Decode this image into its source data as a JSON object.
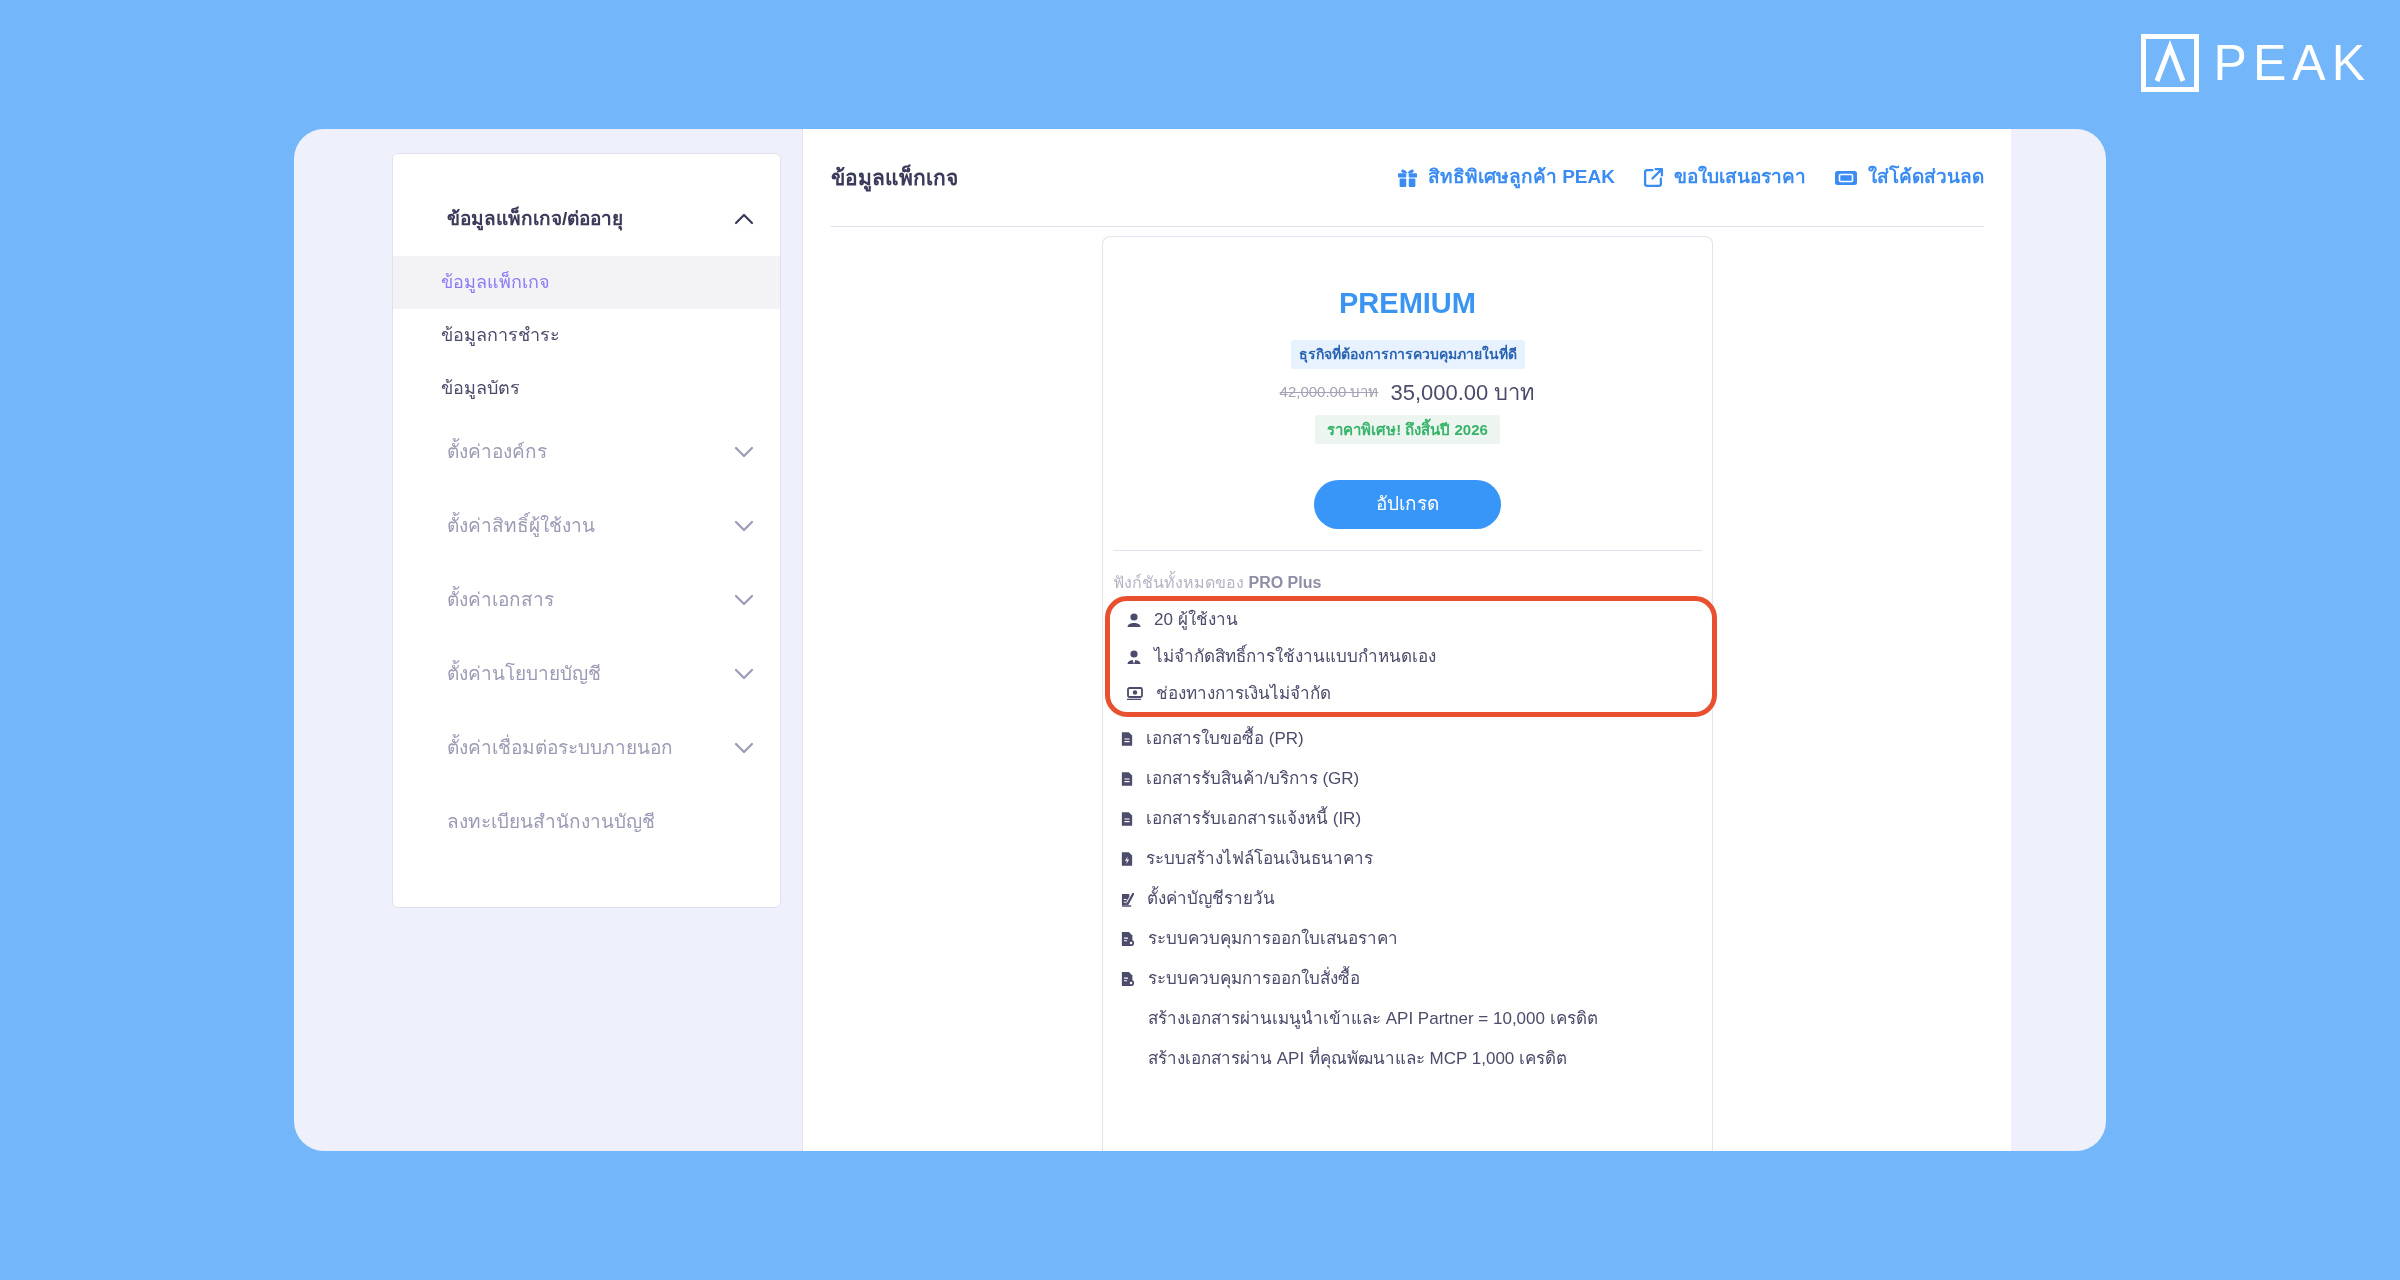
{
  "logo": {
    "text": "PEAK"
  },
  "sidebar": {
    "groups": [
      {
        "kind": "group",
        "label": "ข้อมูลแพ็กเกจ/ต่ออายุ",
        "expanded": true,
        "children": [
          {
            "label": "ข้อมูลแพ็กเกจ",
            "selected": true
          },
          {
            "label": "ข้อมูลการชำระ",
            "selected": false
          },
          {
            "label": "ข้อมูลบัตร",
            "selected": false
          }
        ]
      },
      {
        "kind": "group",
        "label": "ตั้งค่าองค์กร",
        "expanded": false
      },
      {
        "kind": "group",
        "label": "ตั้งค่าสิทธิ์ผู้ใช้งาน",
        "expanded": false
      },
      {
        "kind": "group",
        "label": "ตั้งค่าเอกสาร",
        "expanded": false
      },
      {
        "kind": "group",
        "label": "ตั้งค่านโยบายบัญชี",
        "expanded": false
      },
      {
        "kind": "group",
        "label": "ตั้งค่าเชื่อมต่อระบบภายนอก",
        "expanded": false
      },
      {
        "kind": "link",
        "label": "ลงทะเบียนสำนักงานบัญชี"
      }
    ]
  },
  "header": {
    "title": "ข้อมูลแพ็กเกจ",
    "links": [
      {
        "kind": "gift",
        "label": "สิทธิพิเศษลูกค้า PEAK"
      },
      {
        "kind": "external",
        "label": "ขอใบเสนอราคา"
      },
      {
        "kind": "ticket",
        "label": "ใส่โค้ดส่วนลด"
      }
    ]
  },
  "plan": {
    "name": "PREMIUM",
    "tagline": "ธุรกิจที่ต้องการการควบคุมภายในที่ดี",
    "old_price": "42,000.00 บาท",
    "price": "35,000.00 บาท",
    "promo": "ราคาพิเศษ! ถึงสิ้นปี 2026",
    "button": "อัปเกรด",
    "features_heading": "ฟังก์ชันทั้งหมดของ **PRO Plus**",
    "feature_groups": [
      {
        "highlighted": true,
        "items": [
          {
            "kind": "person",
            "label": "20 ผู้ใช้งาน"
          },
          {
            "kind": "person-tie",
            "label": "ไม่จำกัดสิทธิ์การใช้งานแบบกำหนดเอง"
          },
          {
            "kind": "money",
            "label": "ช่องทางการเงินไม่จำกัด"
          }
        ]
      },
      {
        "highlighted": false,
        "items": [
          {
            "kind": "document",
            "label": "เอกสารใบขอซื้อ (PR)"
          },
          {
            "kind": "document",
            "label": "เอกสารรับสินค้า/บริการ (GR)"
          },
          {
            "kind": "document",
            "label": "เอกสารรับเอกสารแจ้งหนี้ (IR)"
          },
          {
            "kind": "document-bolt",
            "label": "ระบบสร้างไฟล์โอนเงินธนาคาร"
          },
          {
            "kind": "document-pen",
            "label": "ตั้งค่าบัญชีรายวัน"
          },
          {
            "kind": "document-badge",
            "label": "ระบบควบคุมการออกใบเสนอราคา"
          },
          {
            "kind": "document-badge",
            "label": "ระบบควบคุมการออกใบสั่งซื้อ"
          },
          {
            "kind": "text",
            "label": "สร้างเอกสารผ่านเมนูนำเข้าและ API Partner = 10,000 เครดิต"
          },
          {
            "kind": "text",
            "label": "สร้างเอกสารผ่าน API ที่คุณพัฒนาและ MCP 1,000 เครดิต"
          }
        ]
      }
    ]
  }
}
